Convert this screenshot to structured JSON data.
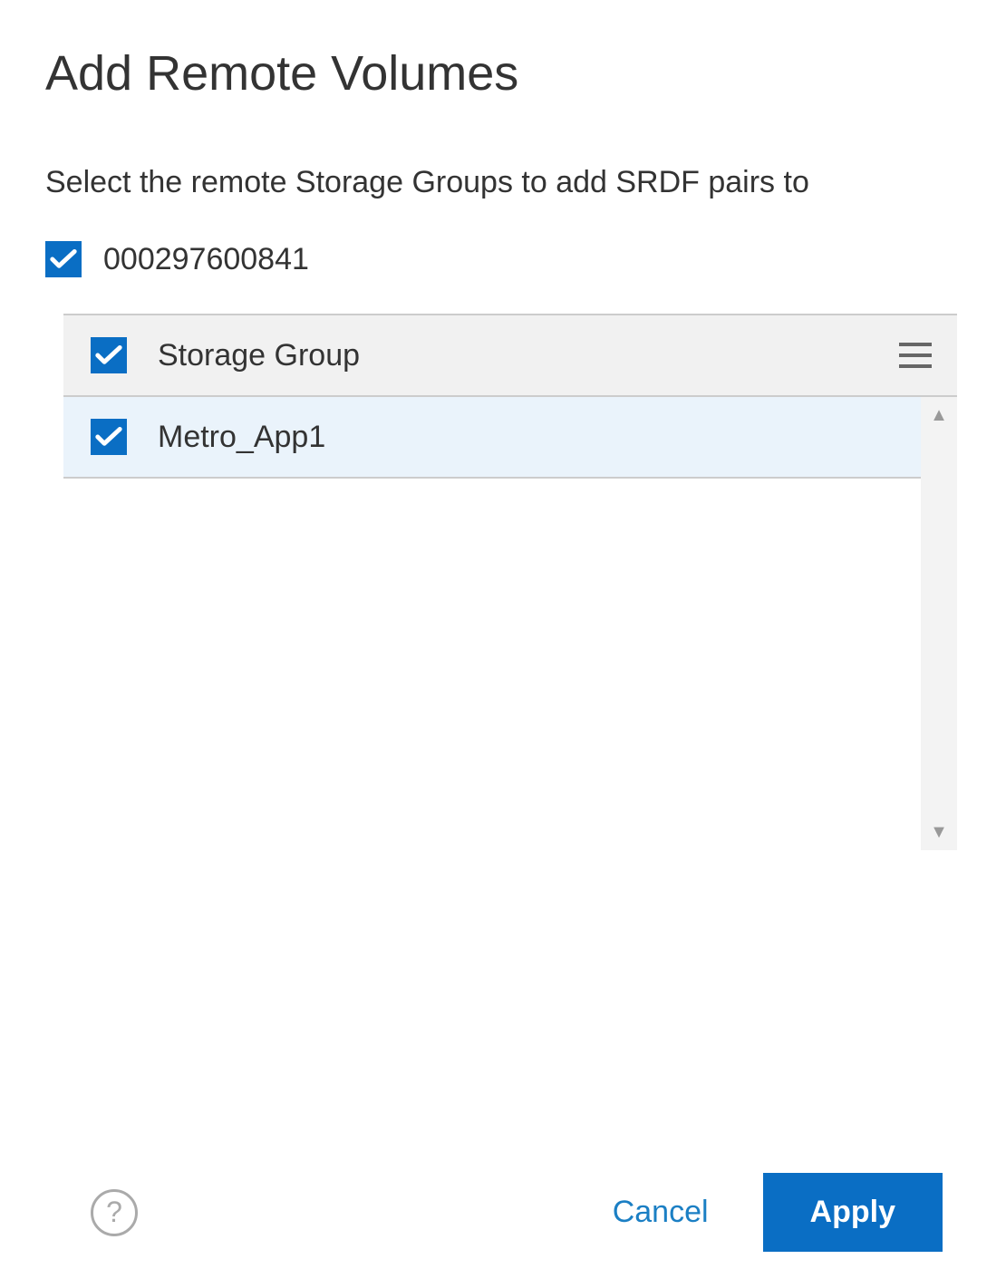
{
  "dialog": {
    "title": "Add Remote Volumes",
    "instruction": "Select the remote Storage Groups to add SRDF pairs to"
  },
  "array": {
    "id": "000297600841",
    "checked": true
  },
  "table": {
    "header_label": "Storage Group",
    "select_all_checked": true,
    "rows": [
      {
        "name": "Metro_App1",
        "checked": true
      }
    ]
  },
  "footer": {
    "cancel_label": "Cancel",
    "apply_label": "Apply"
  }
}
